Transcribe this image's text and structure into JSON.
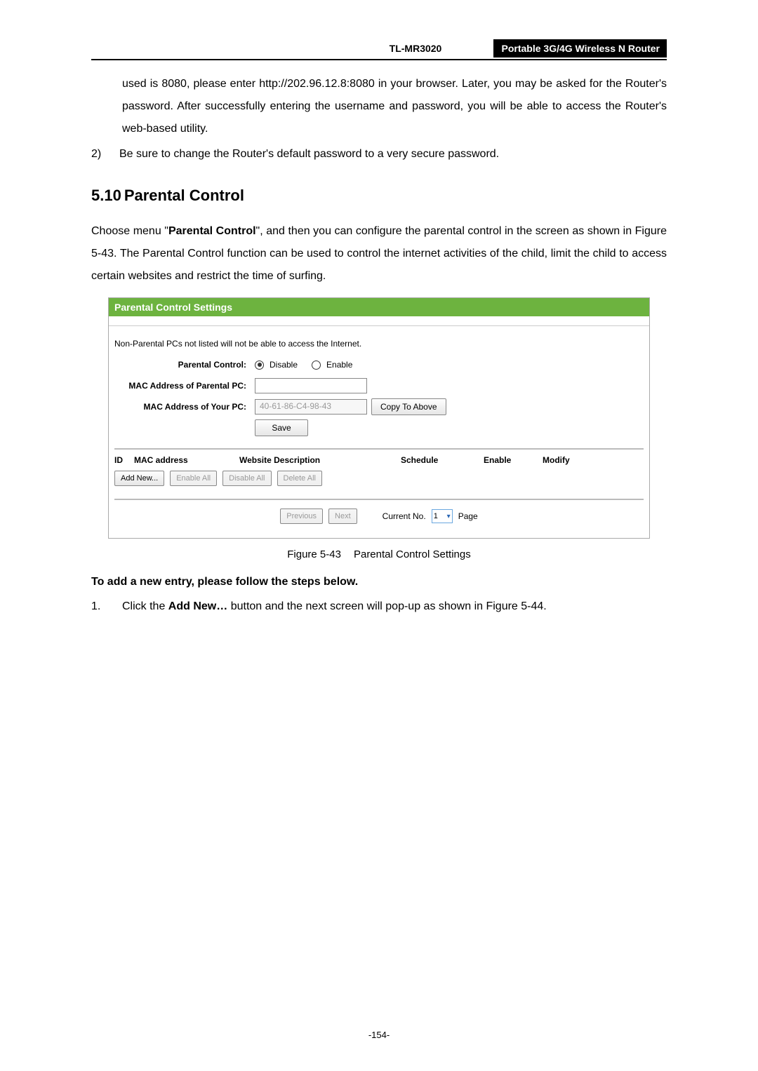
{
  "header": {
    "model": "TL-MR3020",
    "product": "Portable 3G/4G Wireless N Router"
  },
  "intro": {
    "cont": "used is 8080, please enter http://202.96.12.8:8080 in your browser. Later, you may be asked for the Router's password. After successfully entering the username and password, you will be able to access the Router's web-based utility.",
    "item2_num": "2)",
    "item2_text": "Be sure to change the Router's default password to a very secure password."
  },
  "section": {
    "num": "5.10",
    "title": "Parental Control"
  },
  "para1_a": "Choose menu \"",
  "para1_b": "Parental Control",
  "para1_c": "\", and then you can configure the parental control in the screen as shown in Figure 5-43. The Parental Control function can be used to control the internet activities of the child, limit the child to access certain websites and restrict the time of surfing.",
  "panel": {
    "title": "Parental Control Settings",
    "note": "Non-Parental PCs not listed will not be able to access the Internet.",
    "labels": {
      "pc": "Parental Control:",
      "mac_parent": "MAC Address of Parental PC:",
      "mac_your": "MAC Address of Your PC:"
    },
    "radio": {
      "disable": "Disable",
      "enable": "Enable"
    },
    "mac_your_value": "40-61-86-C4-98-43",
    "btn_copy": "Copy To Above",
    "btn_save": "Save",
    "cols": {
      "id": "ID",
      "mac": "MAC address",
      "desc": "Website Description",
      "sched": "Schedule",
      "enable": "Enable",
      "modify": "Modify"
    },
    "btns": {
      "add": "Add New...",
      "en_all": "Enable All",
      "dis_all": "Disable All",
      "del_all": "Delete All"
    },
    "pager": {
      "prev": "Previous",
      "next": "Next",
      "cur": "Current No.",
      "val": "1",
      "page": "Page"
    }
  },
  "fig_caption_a": "Figure 5-43",
  "fig_caption_b": "Parental Control Settings",
  "bold_line": "To add a new entry, please follow the steps below.",
  "step1_num": "1.",
  "step1_a": "Click the ",
  "step1_b": "Add New…",
  "step1_c": " button and the next screen will pop-up as shown in Figure 5-44.",
  "page_no": "-154-"
}
